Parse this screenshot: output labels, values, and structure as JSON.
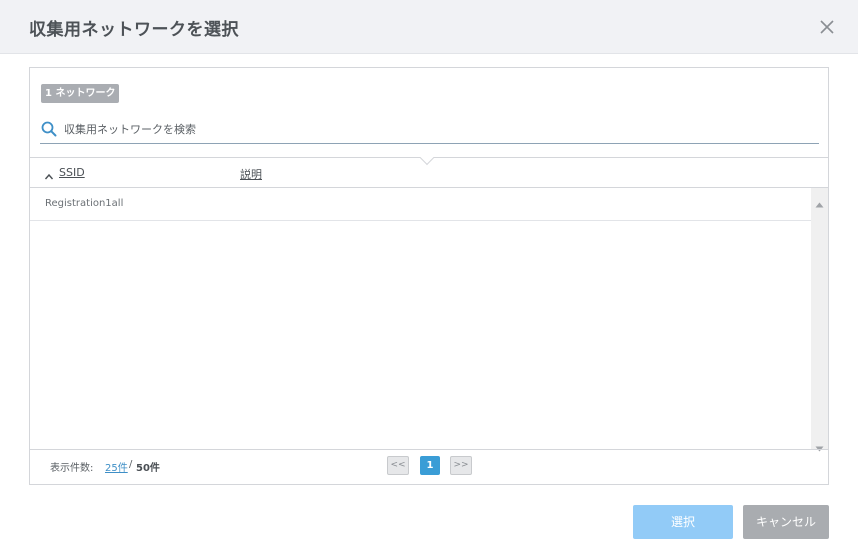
{
  "dialog": {
    "title": "収集用ネットワークを選択"
  },
  "panel": {
    "count_badge": "1 ネットワーク",
    "search": {
      "placeholder": "収集用ネットワークを検索",
      "value": ""
    },
    "columns": {
      "ssid": "SSID",
      "description": "説明"
    },
    "rows": [
      {
        "ssid": "Registration1all",
        "description": ""
      }
    ],
    "footer": {
      "per_page_label": "表示件数:",
      "per_page_current": "25件",
      "separator": "/",
      "per_page_alt": "50件"
    },
    "pagination": {
      "prev": "<<",
      "current": "1",
      "next": ">>"
    }
  },
  "buttons": {
    "select": "選択",
    "cancel": "キャンセル"
  },
  "colors": {
    "accent": "#3a9dd6",
    "select_button": "#92cbf7",
    "cancel_button": "#a9acb0"
  }
}
